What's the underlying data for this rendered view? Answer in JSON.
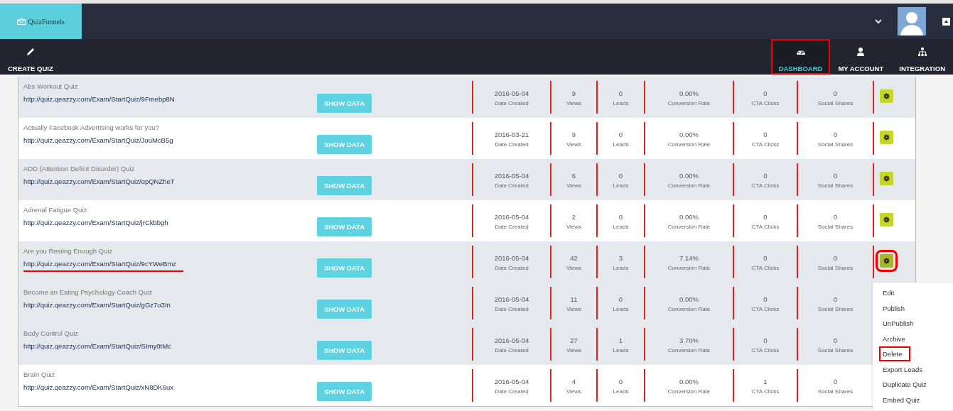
{
  "header": {
    "logo": "QuizFunnels"
  },
  "nav": [
    {
      "label": "CREATE QUIZ",
      "selected": false,
      "marked": false
    },
    {
      "label": "DASHBOARD",
      "selected": true,
      "marked": true
    },
    {
      "label": "MY ACCOUNT",
      "selected": false,
      "marked": false
    },
    {
      "label": "INTEGRATION",
      "selected": false,
      "marked": false
    }
  ],
  "rows": [
    {
      "name": "Abs Workout Quiz",
      "url": "http://quiz.qeazzy.com/Exam/StartQuiz/9Fmebp8N",
      "underlined": false,
      "button": "SHOW DATA",
      "shaded": true,
      "gear": {
        "marked": false
      },
      "stats": [
        {
          "value": "2016-05-04",
          "label": "Date Created"
        },
        {
          "value": "9",
          "label": "Views"
        },
        {
          "value": "0",
          "label": "Leads"
        },
        {
          "value": "0.00%",
          "label": "Conversion Rate"
        },
        {
          "value": "0",
          "label": "CTA Clicks"
        },
        {
          "value": "0",
          "label": "Social Shares"
        }
      ]
    },
    {
      "name": "Actually Facebook Advertising works for you?",
      "url": "http://quiz.qeazzy.com/Exam/StartQuiz/JouMcB5g",
      "underlined": false,
      "button": "SHOW DATA",
      "shaded": false,
      "gear": {
        "marked": false
      },
      "stats": [
        {
          "value": "2016-03-21",
          "label": "Date Created"
        },
        {
          "value": "9",
          "label": "Views"
        },
        {
          "value": "0",
          "label": "Leads"
        },
        {
          "value": "0.00%",
          "label": "Conversion Rate"
        },
        {
          "value": "0",
          "label": "CTA Clicks"
        },
        {
          "value": "0",
          "label": "Social Shares"
        }
      ]
    },
    {
      "name": "ADD (Attention Deficit Disorder) Quiz",
      "url": "http://quiz.qeazzy.com/Exam/StartQuiz/opQNZheT",
      "underlined": false,
      "button": "SHOW DATA",
      "shaded": true,
      "gear": {
        "marked": false
      },
      "stats": [
        {
          "value": "2016-05-04",
          "label": "Date Created"
        },
        {
          "value": "6",
          "label": "Views"
        },
        {
          "value": "0",
          "label": "Leads"
        },
        {
          "value": "0.00%",
          "label": "Conversion Rate"
        },
        {
          "value": "0",
          "label": "CTA Clicks"
        },
        {
          "value": "0",
          "label": "Social Shares"
        }
      ]
    },
    {
      "name": "Adrenal Fatigue Quiz",
      "url": "http://quiz.qeazzy.com/Exam/StartQuiz/jrCkbbgh",
      "underlined": false,
      "button": "SHOW DATA",
      "shaded": false,
      "gear": {
        "marked": false
      },
      "stats": [
        {
          "value": "2016-05-04",
          "label": "Date Created"
        },
        {
          "value": "2",
          "label": "Views"
        },
        {
          "value": "0",
          "label": "Leads"
        },
        {
          "value": "0.00%",
          "label": "Conversion Rate"
        },
        {
          "value": "0",
          "label": "CTA Clicks"
        },
        {
          "value": "0",
          "label": "Social Shares"
        }
      ]
    },
    {
      "name": "Are you Resting Enough Quiz",
      "url": "http://quiz.qeazzy.com/Exam/StartQuiz/9cYWeBmz",
      "underlined": true,
      "button": "SHOW DATA",
      "shaded": true,
      "gear": {
        "marked": true
      },
      "stats": [
        {
          "value": "2016-05-04",
          "label": "Date Created"
        },
        {
          "value": "42",
          "label": "Views"
        },
        {
          "value": "3",
          "label": "Leads"
        },
        {
          "value": "7.14%",
          "label": "Conversion Rate"
        },
        {
          "value": "0",
          "label": "CTA Clicks"
        },
        {
          "value": "0",
          "label": "Social Shares"
        }
      ]
    },
    {
      "name": "Become an Eating Psychology Coach Quiz",
      "url": "http://quiz.qeazzy.com/Exam/StartQuiz/gGz7o3In",
      "underlined": false,
      "button": "SHOW DATA",
      "shaded": true,
      "stats": [
        {
          "value": "2016-05-04",
          "label": "Date Created"
        },
        {
          "value": "11",
          "label": "Views"
        },
        {
          "value": "0",
          "label": "Leads"
        },
        {
          "value": "0.00%",
          "label": "Conversion Rate"
        },
        {
          "value": "0",
          "label": "CTA Clicks"
        },
        {
          "value": "0",
          "label": "Social Shares"
        }
      ]
    },
    {
      "name": "Body Control Quiz",
      "url": "http://quiz.qeazzy.com/Exam/StartQuiz/SImy0tMc",
      "underlined": false,
      "button": "SHOW DATA",
      "shaded": true,
      "stats": [
        {
          "value": "2016-05-04",
          "label": "Date Created"
        },
        {
          "value": "27",
          "label": "Views"
        },
        {
          "value": "1",
          "label": "Leads"
        },
        {
          "value": "3.70%",
          "label": "Conversion Rate"
        },
        {
          "value": "0",
          "label": "CTA Clicks"
        },
        {
          "value": "0",
          "label": "Social Shares"
        }
      ]
    },
    {
      "name": "Brain Quiz",
      "url": "http://quiz.qeazzy.com/Exam/StartQuiz/xN8DK6ux",
      "underlined": false,
      "button": "SHOW DATA",
      "shaded": false,
      "stats": [
        {
          "value": "2016-05-04",
          "label": "Date Created"
        },
        {
          "value": "4",
          "label": "Views"
        },
        {
          "value": "0",
          "label": "Leads"
        },
        {
          "value": "0.00%",
          "label": "Conversion Rate"
        },
        {
          "value": "1",
          "label": "CTA Clicks"
        },
        {
          "value": "0",
          "label": "Social Shares"
        }
      ]
    }
  ],
  "menu": {
    "items": [
      {
        "label": "Edit",
        "marked": false
      },
      {
        "label": "Publish",
        "marked": false
      },
      {
        "label": "UnPublish",
        "marked": false
      },
      {
        "label": "Archive",
        "marked": false
      },
      {
        "label": "Delete",
        "marked": true
      },
      {
        "label": "Export Leads",
        "marked": false
      },
      {
        "label": "Duplicate Quiz",
        "marked": false
      },
      {
        "label": "Embed Quiz",
        "marked": false
      }
    ]
  }
}
